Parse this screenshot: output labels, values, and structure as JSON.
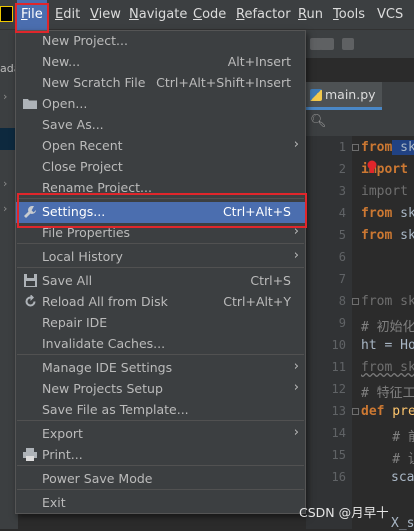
{
  "menubar": {
    "items": [
      {
        "label": "File",
        "mnemonic": "F",
        "rest": "ile"
      },
      {
        "label": "Edit",
        "mnemonic": "E",
        "rest": "dit"
      },
      {
        "label": "View",
        "mnemonic": "V",
        "rest": "iew"
      },
      {
        "label": "Navigate",
        "mnemonic": "N",
        "rest": "avigate"
      },
      {
        "label": "Code",
        "mnemonic": "C",
        "rest": "ode"
      },
      {
        "label": "Refactor",
        "mnemonic": "R",
        "rest": "efactor"
      },
      {
        "label": "Run",
        "mnemonic": "R",
        "rest": "un"
      },
      {
        "label": "Tools",
        "mnemonic": "T",
        "rest": "ools"
      },
      {
        "label": "VCS",
        "mnemonic": "",
        "rest": "VCS"
      }
    ]
  },
  "file_menu": {
    "items": [
      {
        "label": "New Project...",
        "shortcut": "",
        "icon": "",
        "submenu": false
      },
      {
        "label": "New...",
        "shortcut": "Alt+Insert",
        "icon": "",
        "submenu": false
      },
      {
        "label": "New Scratch File",
        "shortcut": "Ctrl+Alt+Shift+Insert",
        "icon": "",
        "submenu": false
      },
      {
        "label": "Open...",
        "shortcut": "",
        "icon": "folder-icon",
        "submenu": false
      },
      {
        "label": "Save As...",
        "shortcut": "",
        "icon": "",
        "submenu": false
      },
      {
        "label": "Open Recent",
        "shortcut": "",
        "icon": "",
        "submenu": true
      },
      {
        "label": "Close Project",
        "shortcut": "",
        "icon": "",
        "submenu": false
      },
      {
        "label": "Rename Project...",
        "shortcut": "",
        "icon": "",
        "submenu": false
      },
      {
        "label": "Settings...",
        "shortcut": "Ctrl+Alt+S",
        "icon": "wrench-icon",
        "submenu": false
      },
      {
        "label": "File Properties",
        "shortcut": "",
        "icon": "",
        "submenu": true
      },
      {
        "label": "Local History",
        "shortcut": "",
        "icon": "",
        "submenu": true
      },
      {
        "label": "Save All",
        "shortcut": "Ctrl+S",
        "icon": "save-icon",
        "submenu": false
      },
      {
        "label": "Reload All from Disk",
        "shortcut": "Ctrl+Alt+Y",
        "icon": "reload-icon",
        "submenu": false
      },
      {
        "label": "Repair IDE",
        "shortcut": "",
        "icon": "",
        "submenu": false
      },
      {
        "label": "Invalidate Caches...",
        "shortcut": "",
        "icon": "",
        "submenu": false
      },
      {
        "label": "Manage IDE Settings",
        "shortcut": "",
        "icon": "",
        "submenu": true
      },
      {
        "label": "New Projects Setup",
        "shortcut": "",
        "icon": "",
        "submenu": true
      },
      {
        "label": "Save File as Template...",
        "shortcut": "",
        "icon": "",
        "submenu": false
      },
      {
        "label": "Export",
        "shortcut": "",
        "icon": "",
        "submenu": true
      },
      {
        "label": "Print...",
        "shortcut": "",
        "icon": "print-icon",
        "submenu": false
      },
      {
        "label": "Power Save Mode",
        "shortcut": "",
        "icon": "",
        "submenu": false
      },
      {
        "label": "Exit",
        "shortcut": "",
        "icon": "",
        "submenu": false
      }
    ],
    "selected": "Settings..."
  },
  "editor": {
    "tab_label": "main.py",
    "line_numbers": [
      "1",
      "2",
      "3",
      "4",
      "5",
      "6",
      "7",
      "8",
      "9",
      "10",
      "11",
      "12",
      "13",
      "14",
      "15",
      "16"
    ],
    "lines": [
      {
        "kw": "from",
        "text": " sk"
      },
      {
        "kw": "import",
        "text": ""
      },
      {
        "kw": "",
        "text": "import"
      },
      {
        "kw": "from",
        "text": " sk"
      },
      {
        "kw": "from",
        "text": " sk"
      },
      {
        "kw": "",
        "text": ""
      },
      {
        "kw": "",
        "text": ""
      },
      {
        "kw": "",
        "text": "from sk"
      },
      {
        "kw": "",
        "text": "# 初始化"
      },
      {
        "kw": "",
        "text": "ht = Ho"
      },
      {
        "kw": "",
        "text": "from sk"
      },
      {
        "kw": "",
        "text": "# 特征工"
      },
      {
        "kw": "def",
        "text": " pre"
      },
      {
        "kw": "",
        "text": "    # 前"
      },
      {
        "kw": "",
        "text": "    # 让"
      },
      {
        "kw": "",
        "text": ""
      }
    ],
    "bottom_fragment_1": "sca",
    "bottom_fragment_2": "X_s"
  },
  "left_fragment": {
    "top": "ada"
  },
  "watermark": "CSDN @月早十",
  "colors": {
    "accent": "#4b6eaf",
    "highlight_box": "#e0262b",
    "keyword": "#cc7832"
  }
}
